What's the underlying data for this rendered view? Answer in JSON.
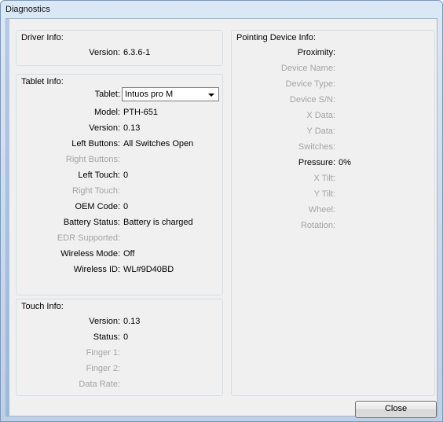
{
  "window": {
    "title": "Diagnostics"
  },
  "driver_info": {
    "title": "Driver Info:",
    "version_label": "Version:",
    "version_value": "6.3.6-1"
  },
  "tablet_info": {
    "title": "Tablet Info:",
    "tablet_label": "Tablet:",
    "tablet_selected": "Intuos pro M",
    "rows": [
      {
        "label": "Model:",
        "value": "PTH-651",
        "enabled": true
      },
      {
        "label": "Version:",
        "value": "0.13",
        "enabled": true
      },
      {
        "label": "Left Buttons:",
        "value": "All Switches Open",
        "enabled": true
      },
      {
        "label": "Right Buttons:",
        "value": "",
        "enabled": false
      },
      {
        "label": "Left Touch:",
        "value": "0",
        "enabled": true
      },
      {
        "label": "Right Touch:",
        "value": "",
        "enabled": false
      },
      {
        "label": "OEM Code:",
        "value": "0",
        "enabled": true
      },
      {
        "label": "Battery Status:",
        "value": "Battery is charged",
        "enabled": true
      },
      {
        "label": "EDR Supported:",
        "value": "",
        "enabled": false
      },
      {
        "label": "Wireless Mode:",
        "value": "Off",
        "enabled": true
      },
      {
        "label": "Wireless ID:",
        "value": "WL#9D40BD",
        "enabled": true
      }
    ]
  },
  "touch_info": {
    "title": "Touch Info:",
    "rows": [
      {
        "label": "Version:",
        "value": "0.13",
        "enabled": true
      },
      {
        "label": "Status:",
        "value": "0",
        "enabled": true
      },
      {
        "label": "Finger 1:",
        "value": "",
        "enabled": false
      },
      {
        "label": "Finger 2:",
        "value": "",
        "enabled": false
      },
      {
        "label": "Data Rate:",
        "value": "",
        "enabled": false
      }
    ]
  },
  "pointing_info": {
    "title": "Pointing Device Info:",
    "rows": [
      {
        "label": "Proximity:",
        "value": "",
        "enabled": true
      },
      {
        "label": "Device Name:",
        "value": "",
        "enabled": false
      },
      {
        "label": "Device Type:",
        "value": "",
        "enabled": false
      },
      {
        "label": "Device S/N:",
        "value": "",
        "enabled": false
      },
      {
        "label": "X Data:",
        "value": "",
        "enabled": false
      },
      {
        "label": "Y Data:",
        "value": "",
        "enabled": false
      },
      {
        "label": "Switches:",
        "value": "",
        "enabled": false
      },
      {
        "label": "Pressure:",
        "value": "0%",
        "enabled": true
      },
      {
        "label": "X Tilt:",
        "value": "",
        "enabled": false
      },
      {
        "label": "Y Tilt:",
        "value": "",
        "enabled": false
      },
      {
        "label": "Wheel:",
        "value": "",
        "enabled": false
      },
      {
        "label": "Rotation:",
        "value": "",
        "enabled": false
      }
    ]
  },
  "buttons": {
    "close_label": "Close"
  }
}
